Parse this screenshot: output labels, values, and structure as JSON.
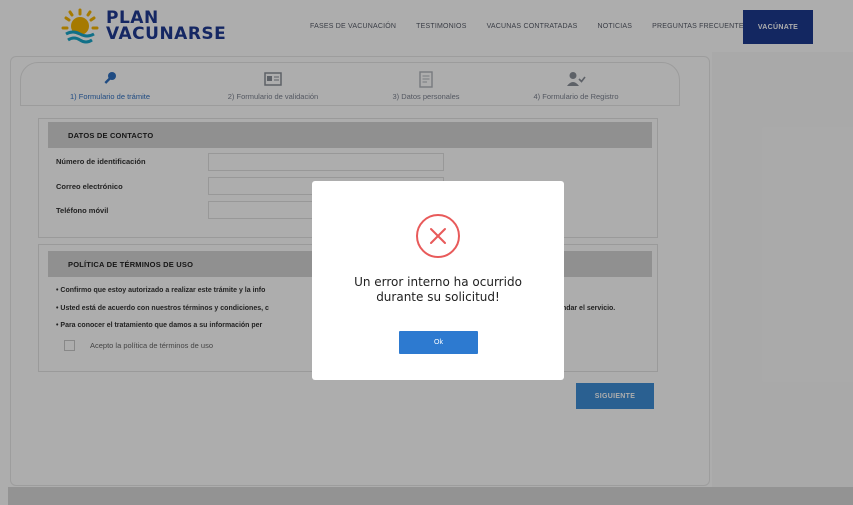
{
  "header": {
    "logo_line1": "PLAN",
    "logo_line2": "VACUNARSE",
    "nav": [
      "FASES DE VACUNACIÓN",
      "TESTIMONIOS",
      "VACUNAS CONTRATADAS",
      "NOTICIAS",
      "PREGUNTAS FRECUENTES"
    ],
    "cta_label": "VACÚNATE"
  },
  "steps": [
    {
      "label": "1) Formulario de trámite",
      "icon": "key-icon"
    },
    {
      "label": "2) Formulario de validación",
      "icon": "id-card-icon"
    },
    {
      "label": "3) Datos personales",
      "icon": "document-icon"
    },
    {
      "label": "4) Formulario de Registro",
      "icon": "user-check-icon"
    }
  ],
  "contact": {
    "title": "DATOS DE CONTACTO",
    "fields": [
      "Número de identificación",
      "Correo electrónico",
      "Teléfono móvil"
    ]
  },
  "policy": {
    "title": "POLÍTICA DE TÉRMINOS DE USO",
    "lines": [
      "•  Confirmo que estoy autorizado a realizar este trámite y la info",
      "•  Usted está de acuerdo con nuestros términos y condiciones, c",
      "•  Para conocer el tratamiento que damos a su información per"
    ],
    "line2_tail": "brindar el servicio.",
    "checkbox_label": "Acepto la política de términos de uso"
  },
  "next_button": "SIGUIENTE",
  "modal": {
    "message_line1": "Un error interno ha ocurrido",
    "message_line2": "durante su solicitud!",
    "ok_label": "Ok"
  },
  "colors": {
    "brand_blue": "#1d3a8f",
    "accent_blue": "#2d7ad0",
    "error_red": "#e85a5a"
  }
}
